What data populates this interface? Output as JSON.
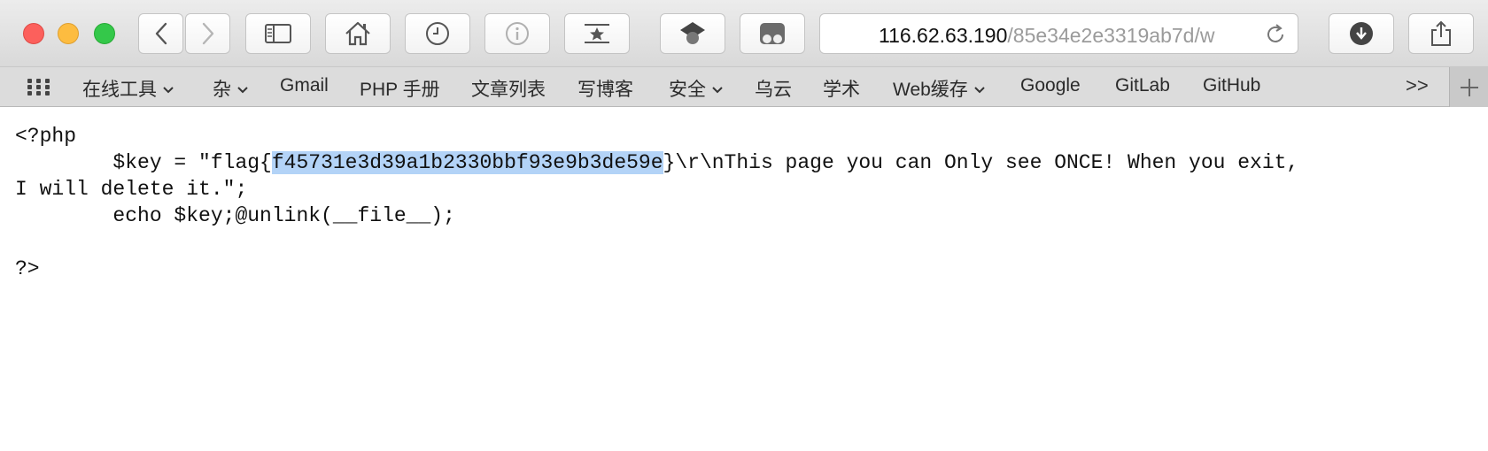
{
  "browser": {
    "address": {
      "host": "116.62.63.190",
      "path": "/85e34e2e3319ab7d/w"
    },
    "icons": {
      "back": "chevron-left-icon",
      "forward": "chevron-right-icon",
      "sidebar": "sidebar-icon",
      "home": "home-icon",
      "history": "clock-icon",
      "info": "info-icon",
      "bookmark": "star-bookmark-icon",
      "extension1": "extension-icon",
      "extension2": "extension-icon",
      "reload": "reload-icon",
      "download": "download-icon",
      "share": "share-icon"
    }
  },
  "bookmarks": {
    "items": [
      {
        "label": "在线工具",
        "dropdown": true
      },
      {
        "label": "杂",
        "dropdown": true
      },
      {
        "label": "Gmail",
        "dropdown": false
      },
      {
        "label": "PHP 手册",
        "dropdown": false
      },
      {
        "label": "文章列表",
        "dropdown": false
      },
      {
        "label": "写博客",
        "dropdown": false
      },
      {
        "label": "安全",
        "dropdown": true
      },
      {
        "label": "乌云",
        "dropdown": false
      },
      {
        "label": "学术",
        "dropdown": false
      },
      {
        "label": "Web缓存",
        "dropdown": true
      },
      {
        "label": "Google",
        "dropdown": false
      },
      {
        "label": "GitLab",
        "dropdown": false
      },
      {
        "label": "GitHub",
        "dropdown": false
      }
    ],
    "more_label": ">>",
    "add_label": "+"
  },
  "page": {
    "line1": "<?php",
    "line2_pre": "        $key = \"flag{",
    "line2_sel": "f45731e3d39a1b2330bbf93e9b3de59e",
    "line2_post": "}\\r\\nThis page you can Only see ONCE! When you exit,",
    "line3": "I will delete it.\";",
    "line4": "        echo $key;@unlink(__file__);",
    "line5": "",
    "line6": "?>"
  },
  "colors": {
    "selection": "#b3d3f7",
    "close": "#fc605c",
    "minimize": "#fdbc40",
    "zoom": "#34c84a"
  }
}
